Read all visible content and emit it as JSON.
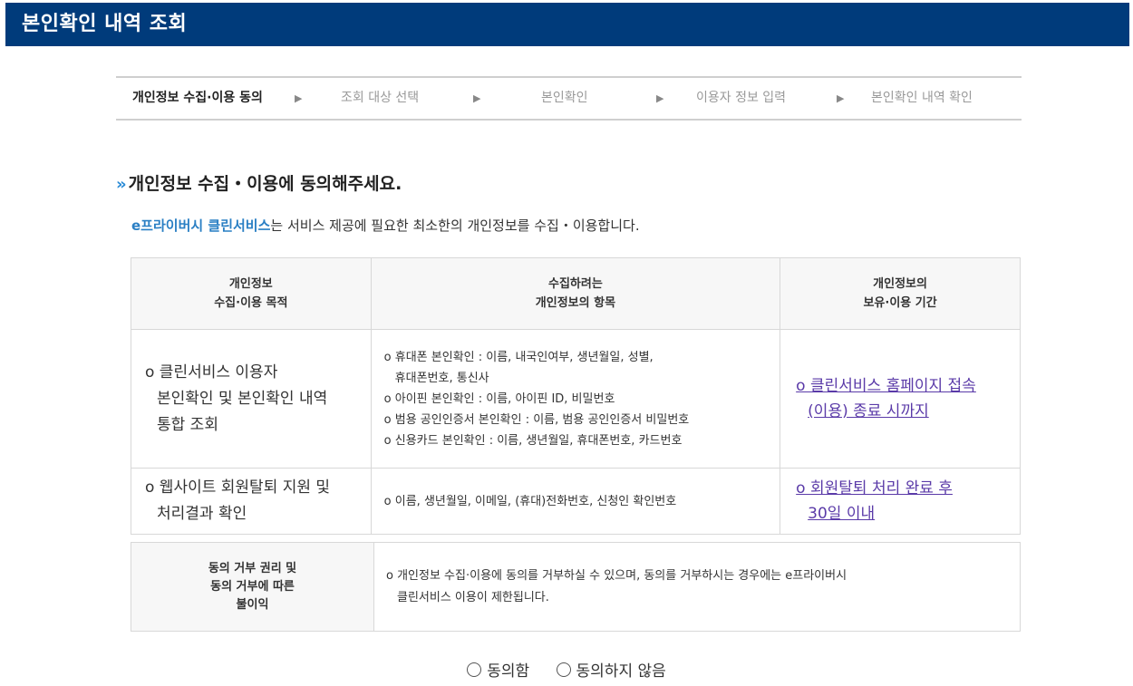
{
  "header": {
    "title": "본인확인 내역 조회"
  },
  "steps": [
    {
      "label": "개인정보 수집·이용 동의",
      "active": true
    },
    {
      "label": "조회 대상 선택"
    },
    {
      "label": "본인확인"
    },
    {
      "label": "이용자 정보 입력"
    },
    {
      "label": "본인확인 내역 확인"
    }
  ],
  "step_arrow": "▶",
  "section": {
    "title": "개인정보 수집・이용에 동의해주세요.",
    "chevron": "»"
  },
  "intro": {
    "brand": "e프라이버시 클린서비스",
    "text": "는 서비스 제공에 필요한 최소한의 개인정보를 수집・이용합니다."
  },
  "table": {
    "headers": [
      [
        "개인정보",
        "수집·이용 목적"
      ],
      [
        "수집하려는",
        "개인정보의 항목"
      ],
      [
        "개인정보의",
        "보유·이용 기간"
      ]
    ],
    "rows": [
      {
        "purpose": [
          "o 클린서비스 이용자",
          "본인확인 및 본인확인 내역",
          "통합 조회"
        ],
        "items": [
          "o 휴대폰 본인확인 : 이름, 내국인여부, 생년월일, 성별,",
          "휴대폰번호, 통신사",
          "o 아이핀 본인확인 : 이름, 아이핀 ID, 비밀번호",
          "o 범용 공인인증서 본인확인 : 이름, 범용 공인인증서 비밀번호",
          "o 신용카드 본인확인 : 이름, 생년월일, 휴대폰번호, 카드번호"
        ],
        "period": [
          "o 클린서비스 홈페이지 접속",
          "(이용) 종료 시까지"
        ]
      },
      {
        "purpose": [
          "o 웹사이트 회원탈퇴 지원 및",
          "처리결과 확인"
        ],
        "items": [
          "o 이름, 생년월일, 이메일, (휴대)전화번호, 신청인 확인번호"
        ],
        "period": [
          "o 회원탈퇴 처리 완료 후",
          "30일 이내"
        ]
      }
    ]
  },
  "refusal": {
    "header": [
      "동의 거부 권리 및",
      "동의 거부에 따른",
      "불이익"
    ],
    "text": [
      "o 개인정보 수집·이용에 동의를 거부하실 수 있으며, 동의를 거부하시는 경우에는 e프라이버시",
      "클린서비스 이용이 제한됩니다."
    ]
  },
  "consent": {
    "agree": "동의함",
    "disagree": "동의하지 않음"
  }
}
